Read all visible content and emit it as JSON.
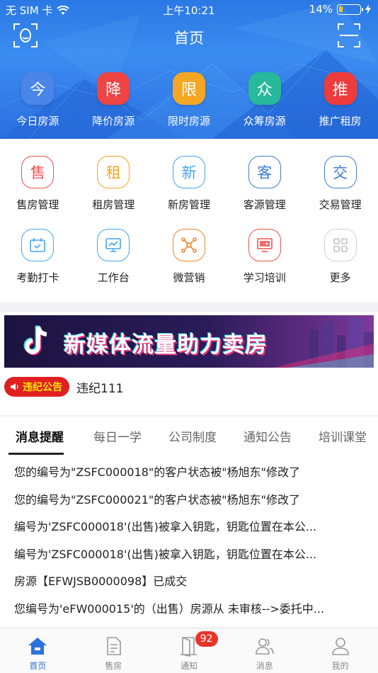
{
  "status_bar": {
    "carrier": "无 SIM 卡",
    "time": "上午10:21",
    "battery_percent": "14%"
  },
  "nav": {
    "title": "首页"
  },
  "quick_links": [
    {
      "char": "今",
      "label": "今日房源",
      "color": "#4a86e8"
    },
    {
      "char": "降",
      "label": "降价房源",
      "color": "#ee4444"
    },
    {
      "char": "限",
      "label": "限时房源",
      "color": "#f5a623"
    },
    {
      "char": "众",
      "label": "众筹房源",
      "color": "#26b99a"
    },
    {
      "char": "推",
      "label": "推广租房",
      "color": "#ee3b3b"
    }
  ],
  "grid_row1": [
    {
      "char": "售",
      "label": "售房管理",
      "color": "#ef5350"
    },
    {
      "char": "租",
      "label": "租房管理",
      "color": "#f5a623"
    },
    {
      "char": "新",
      "label": "新房管理",
      "color": "#42a5f5"
    },
    {
      "char": "客",
      "label": "客源管理",
      "color": "#3d7bd8"
    },
    {
      "char": "交",
      "label": "交易管理",
      "color": "#3d7bd8"
    }
  ],
  "grid_row2": [
    {
      "icon": "calendar-check-icon",
      "label": "考勤打卡",
      "color": "#42a5f5"
    },
    {
      "icon": "monitor-chart-icon",
      "label": "工作台",
      "color": "#42a5f5"
    },
    {
      "icon": "network-icon",
      "label": "微营销",
      "color": "#f5832a"
    },
    {
      "icon": "presentation-icon",
      "label": "学习培训",
      "color": "#ef5350"
    },
    {
      "icon": "grid-icon",
      "label": "更多",
      "color": "#c8c8c8"
    }
  ],
  "banner": {
    "text": "新媒体流量助力卖房"
  },
  "notice": {
    "badge": "违纪公告",
    "text": "违纪111"
  },
  "tabs": [
    "消息提醒",
    "每日一学",
    "公司制度",
    "通知公告",
    "培训课堂"
  ],
  "active_tab": 0,
  "messages": [
    "您的编号为\"ZSFC000018\"的客户状态被\"杨旭东\"修改了",
    "您的编号为\"ZSFC000021\"的客户状态被\"杨旭东\"修改了",
    "编号为'ZSFC000018'(出售)被拿入钥匙，钥匙位置在本公...",
    "编号为'ZSFC000018'(出售)被拿入钥匙，钥匙位置在本公...",
    "房源【EFWJSB0000098】已成交",
    "您编号为'eFW000015'的（出售）房源从 未审核-->委托中..."
  ],
  "tabbar": [
    {
      "label": "首页",
      "icon": "home-icon"
    },
    {
      "label": "售房",
      "icon": "document-icon"
    },
    {
      "label": "通知",
      "icon": "door-icon",
      "badge": "92"
    },
    {
      "label": "消息",
      "icon": "people-icon"
    },
    {
      "label": "我的",
      "icon": "person-icon"
    }
  ],
  "colors": {
    "accent": "#2d72dc",
    "header": "#2f7de6",
    "badge_red": "#e9342c"
  }
}
